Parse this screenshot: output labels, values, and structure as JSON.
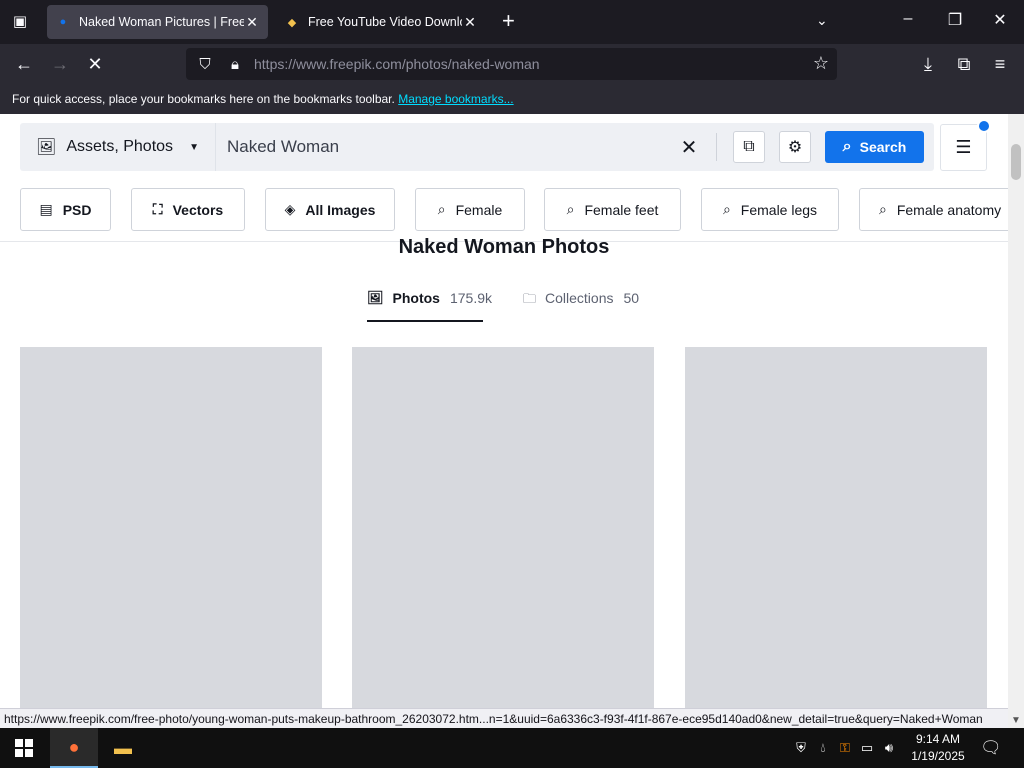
{
  "browser": {
    "tabs": [
      {
        "title": "Naked Woman Pictures | Freepik",
        "favicon_icon": "freepik-icon",
        "active": true
      },
      {
        "title": "Free YouTube Video Downloader",
        "favicon_icon": "downloader-icon",
        "active": false
      }
    ],
    "url_host": "https://www.freepik.com",
    "url_path": "/photos/naked-woman",
    "bookmarks_text": "For quick access, place your bookmarks here on the bookmarks toolbar.",
    "bookmarks_link": "Manage bookmarks...",
    "status_url": "https://www.freepik.com/free-photo/young-woman-puts-makeup-bathroom_26203072.htm...n=1&uuid=6a6336c3-f93f-4f1f-867e-ece95d140ad0&new_detail=true&query=Naked+Woman"
  },
  "search": {
    "asset_type": "Assets, Photos",
    "query": "Naked Woman",
    "button_label": "Search"
  },
  "chips": [
    "PSD",
    "Vectors",
    "All Images",
    "Female",
    "Female feet",
    "Female legs",
    "Female anatomy"
  ],
  "page": {
    "title": "Naked Woman Photos",
    "tabs": [
      {
        "label": "Photos",
        "count": "175.9k"
      },
      {
        "label": "Collections",
        "count": "50"
      }
    ]
  },
  "taskbar": {
    "time": "9:14 AM",
    "date": "1/19/2025"
  },
  "colors": {
    "accent": "#1273eb",
    "browser_dark": "#1c1b22",
    "toolbar": "#2b2a33"
  }
}
